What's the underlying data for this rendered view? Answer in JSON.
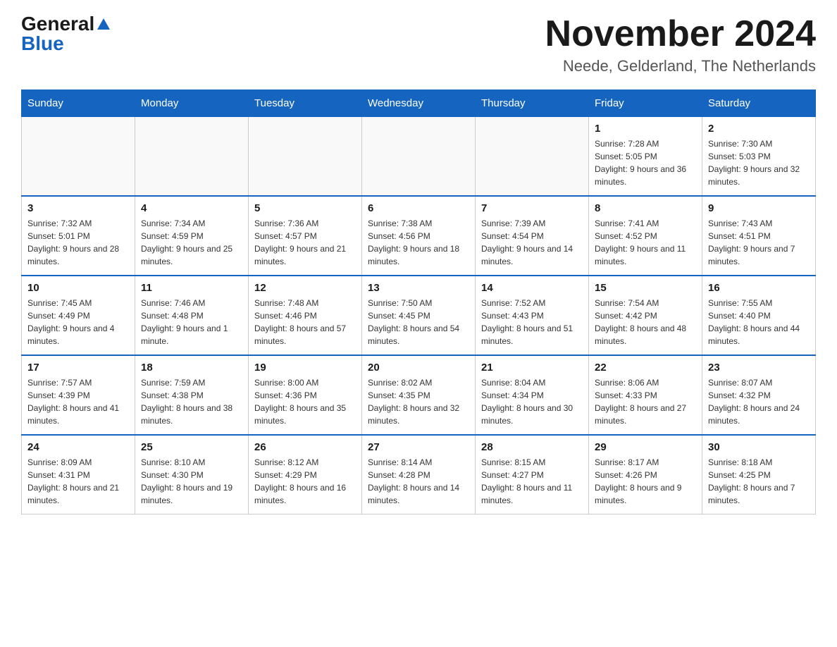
{
  "logo": {
    "general": "General",
    "blue": "Blue"
  },
  "title": "November 2024",
  "location": "Neede, Gelderland, The Netherlands",
  "days_of_week": [
    "Sunday",
    "Monday",
    "Tuesday",
    "Wednesday",
    "Thursday",
    "Friday",
    "Saturday"
  ],
  "weeks": [
    [
      {
        "day": "",
        "info": ""
      },
      {
        "day": "",
        "info": ""
      },
      {
        "day": "",
        "info": ""
      },
      {
        "day": "",
        "info": ""
      },
      {
        "day": "",
        "info": ""
      },
      {
        "day": "1",
        "info": "Sunrise: 7:28 AM\nSunset: 5:05 PM\nDaylight: 9 hours and 36 minutes."
      },
      {
        "day": "2",
        "info": "Sunrise: 7:30 AM\nSunset: 5:03 PM\nDaylight: 9 hours and 32 minutes."
      }
    ],
    [
      {
        "day": "3",
        "info": "Sunrise: 7:32 AM\nSunset: 5:01 PM\nDaylight: 9 hours and 28 minutes."
      },
      {
        "day": "4",
        "info": "Sunrise: 7:34 AM\nSunset: 4:59 PM\nDaylight: 9 hours and 25 minutes."
      },
      {
        "day": "5",
        "info": "Sunrise: 7:36 AM\nSunset: 4:57 PM\nDaylight: 9 hours and 21 minutes."
      },
      {
        "day": "6",
        "info": "Sunrise: 7:38 AM\nSunset: 4:56 PM\nDaylight: 9 hours and 18 minutes."
      },
      {
        "day": "7",
        "info": "Sunrise: 7:39 AM\nSunset: 4:54 PM\nDaylight: 9 hours and 14 minutes."
      },
      {
        "day": "8",
        "info": "Sunrise: 7:41 AM\nSunset: 4:52 PM\nDaylight: 9 hours and 11 minutes."
      },
      {
        "day": "9",
        "info": "Sunrise: 7:43 AM\nSunset: 4:51 PM\nDaylight: 9 hours and 7 minutes."
      }
    ],
    [
      {
        "day": "10",
        "info": "Sunrise: 7:45 AM\nSunset: 4:49 PM\nDaylight: 9 hours and 4 minutes."
      },
      {
        "day": "11",
        "info": "Sunrise: 7:46 AM\nSunset: 4:48 PM\nDaylight: 9 hours and 1 minute."
      },
      {
        "day": "12",
        "info": "Sunrise: 7:48 AM\nSunset: 4:46 PM\nDaylight: 8 hours and 57 minutes."
      },
      {
        "day": "13",
        "info": "Sunrise: 7:50 AM\nSunset: 4:45 PM\nDaylight: 8 hours and 54 minutes."
      },
      {
        "day": "14",
        "info": "Sunrise: 7:52 AM\nSunset: 4:43 PM\nDaylight: 8 hours and 51 minutes."
      },
      {
        "day": "15",
        "info": "Sunrise: 7:54 AM\nSunset: 4:42 PM\nDaylight: 8 hours and 48 minutes."
      },
      {
        "day": "16",
        "info": "Sunrise: 7:55 AM\nSunset: 4:40 PM\nDaylight: 8 hours and 44 minutes."
      }
    ],
    [
      {
        "day": "17",
        "info": "Sunrise: 7:57 AM\nSunset: 4:39 PM\nDaylight: 8 hours and 41 minutes."
      },
      {
        "day": "18",
        "info": "Sunrise: 7:59 AM\nSunset: 4:38 PM\nDaylight: 8 hours and 38 minutes."
      },
      {
        "day": "19",
        "info": "Sunrise: 8:00 AM\nSunset: 4:36 PM\nDaylight: 8 hours and 35 minutes."
      },
      {
        "day": "20",
        "info": "Sunrise: 8:02 AM\nSunset: 4:35 PM\nDaylight: 8 hours and 32 minutes."
      },
      {
        "day": "21",
        "info": "Sunrise: 8:04 AM\nSunset: 4:34 PM\nDaylight: 8 hours and 30 minutes."
      },
      {
        "day": "22",
        "info": "Sunrise: 8:06 AM\nSunset: 4:33 PM\nDaylight: 8 hours and 27 minutes."
      },
      {
        "day": "23",
        "info": "Sunrise: 8:07 AM\nSunset: 4:32 PM\nDaylight: 8 hours and 24 minutes."
      }
    ],
    [
      {
        "day": "24",
        "info": "Sunrise: 8:09 AM\nSunset: 4:31 PM\nDaylight: 8 hours and 21 minutes."
      },
      {
        "day": "25",
        "info": "Sunrise: 8:10 AM\nSunset: 4:30 PM\nDaylight: 8 hours and 19 minutes."
      },
      {
        "day": "26",
        "info": "Sunrise: 8:12 AM\nSunset: 4:29 PM\nDaylight: 8 hours and 16 minutes."
      },
      {
        "day": "27",
        "info": "Sunrise: 8:14 AM\nSunset: 4:28 PM\nDaylight: 8 hours and 14 minutes."
      },
      {
        "day": "28",
        "info": "Sunrise: 8:15 AM\nSunset: 4:27 PM\nDaylight: 8 hours and 11 minutes."
      },
      {
        "day": "29",
        "info": "Sunrise: 8:17 AM\nSunset: 4:26 PM\nDaylight: 8 hours and 9 minutes."
      },
      {
        "day": "30",
        "info": "Sunrise: 8:18 AM\nSunset: 4:25 PM\nDaylight: 8 hours and 7 minutes."
      }
    ]
  ]
}
